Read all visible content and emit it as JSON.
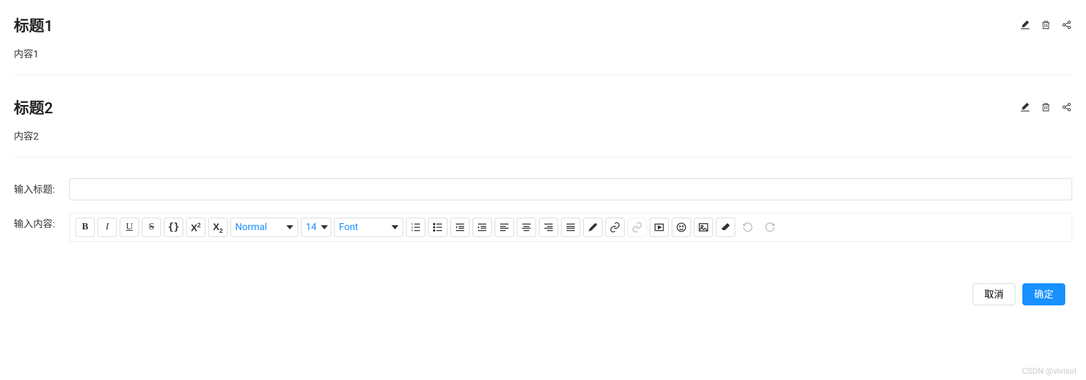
{
  "items": [
    {
      "title": "标题1",
      "content": "内容1"
    },
    {
      "title": "标题2",
      "content": "内容2"
    }
  ],
  "form": {
    "title_label": "输入标题:",
    "content_label": "输入内容:",
    "title_value": ""
  },
  "toolbar": {
    "heading": "Normal",
    "size": "14",
    "font": "Font"
  },
  "footer": {
    "cancel": "取消",
    "confirm": "确定"
  },
  "watermark": "CSDN @vivisol"
}
